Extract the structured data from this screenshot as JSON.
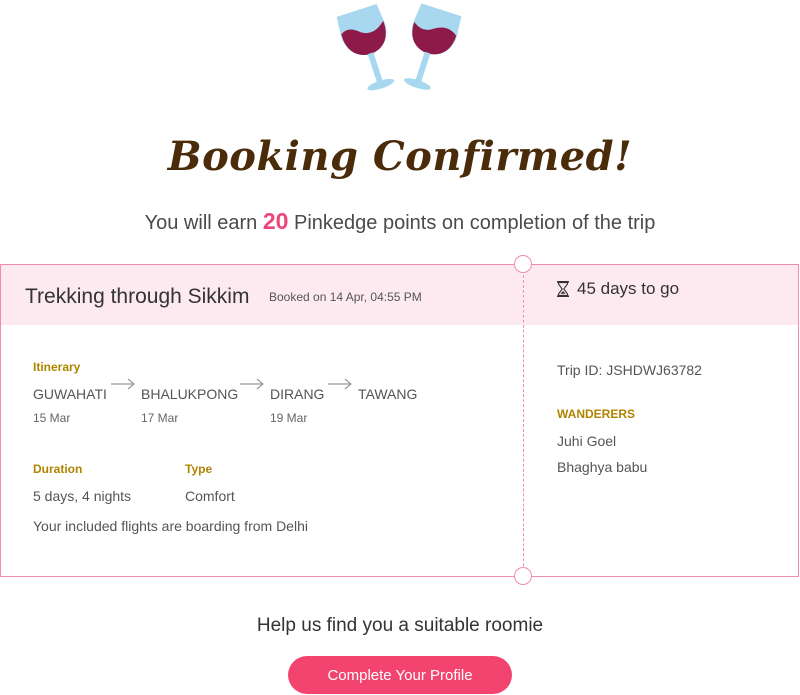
{
  "header": {
    "title": "Booking Confirmed!",
    "points_prefix": "You will earn ",
    "points_value": "20",
    "points_suffix": " Pinkedge points on completion of the trip"
  },
  "booking": {
    "trip_name": "Trekking through Sikkim",
    "booked_on": "Booked on 14 Apr, 04:55 PM",
    "countdown": "45 days to go",
    "itinerary_label": "Itinerary",
    "stops": [
      {
        "place": "GUWAHATI",
        "date": "15 Mar"
      },
      {
        "place": "BHALUKPONG",
        "date": "17 Mar"
      },
      {
        "place": "DIRANG",
        "date": "19 Mar"
      },
      {
        "place": "TAWANG",
        "date": ""
      }
    ],
    "duration_label": "Duration",
    "duration_value": "5 days, 4 nights",
    "type_label": "Type",
    "type_value": "Comfort",
    "flights_note": "Your included flights are boarding from Delhi",
    "trip_id": "Trip ID: JSHDWJ63782",
    "wanderers_label": "WANDERERS",
    "wanderers": [
      "Juhi Goel",
      "Bhaghya babu"
    ]
  },
  "footer": {
    "roomie_text": "Help us find you a suitable roomie",
    "cta_label": "Complete Your Profile"
  },
  "colors": {
    "accent_pink": "#f2446f",
    "border_pink": "#f28cab",
    "header_bg": "#fdeaf0",
    "gold_label": "#b08400",
    "title_brown": "#4a2c0a"
  },
  "icons": {
    "celebration": "wine-glasses-toast-icon",
    "countdown": "hourglass-icon",
    "route_arrow": "arrow-right-icon"
  }
}
